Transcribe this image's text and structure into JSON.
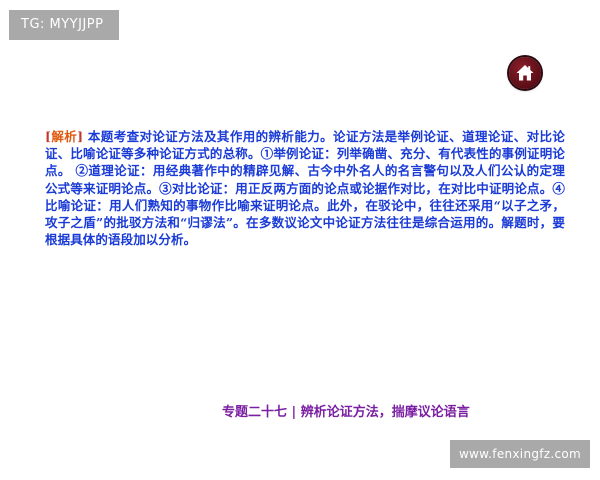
{
  "badge": {
    "label": "TG: MYYJJPP"
  },
  "home_button": {
    "icon": "home-icon"
  },
  "analysis": {
    "tag_open": "[",
    "tag_label": "解析",
    "tag_close": "]",
    "body": " 本题考查对论证方法及其作用的辨析能力。论证方法是举例论证、道理论证、对比论证、比喻论证等多种论证方式的总称。①举例论证：列举确凿、充分、有代表性的事例证明论点。 ②道理论证：用经典著作中的精辟见解、古今中外名人的名言警句以及人们公认的定理公式等来证明论点。③对比论证：用正反两方面的论点或论据作对比，在对比中证明论点。④比喻论证：用人们熟知的事物作比喻来证明论点。此外，在驳论中，往往还采用“以子之矛，攻子之盾”的批驳方法和“归谬法”。在多数议论文中论证方法往往是综合运用的。解题时，要根据具体的语段加以分析。"
  },
  "footer": {
    "title": "专题二十七 | 辨析论证方法，揣摩议论语言"
  },
  "watermark": {
    "text": "www.fenxingfz.com"
  },
  "colors": {
    "body_text": "#1a3bd6",
    "tag": "#e05a10",
    "footer": "#7a1fa2",
    "home_button": "#5a0d16",
    "badge_bg": "#a9a9a9"
  }
}
